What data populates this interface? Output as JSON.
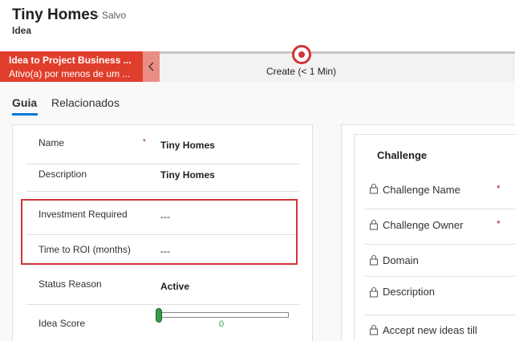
{
  "header": {
    "title": "Tiny Homes",
    "status": "– Salvo",
    "entity": "Idea"
  },
  "bpf": {
    "active_title": "Idea to Project Business ...",
    "active_sub": "Ativo(a) por menos de um ...",
    "collapse_icon": "chevron-left-icon",
    "stage_label": "Create  (< 1 Min)"
  },
  "tabs": [
    {
      "label": "Guia",
      "selected": true
    },
    {
      "label": "Relacionados",
      "selected": false
    }
  ],
  "form": {
    "fields": [
      {
        "label": "Name",
        "required": "*",
        "value": "Tiny Homes"
      },
      {
        "label": "Description",
        "value": "Tiny Homes"
      },
      {
        "label": "Investment Required",
        "value": "---"
      },
      {
        "label": "Time to ROI (months)",
        "value": "---"
      },
      {
        "label": "Status Reason",
        "value": "Active"
      },
      {
        "label": "Idea Score",
        "value": "0"
      }
    ],
    "idea_score_level": 0
  },
  "challenge": {
    "title": "Challenge",
    "fields": [
      {
        "label": "Challenge Name",
        "required": "*"
      },
      {
        "label": "Challenge Owner",
        "required": "*"
      },
      {
        "label": "Domain"
      },
      {
        "label": "Description"
      },
      {
        "label": "Accept new ideas till"
      }
    ],
    "lock_icon": "lock-icon"
  },
  "colors": {
    "bpf_active": "#e03e2d",
    "accent": "#0078d4",
    "highlight": "#d13438",
    "slider": "#3a9a4b"
  }
}
